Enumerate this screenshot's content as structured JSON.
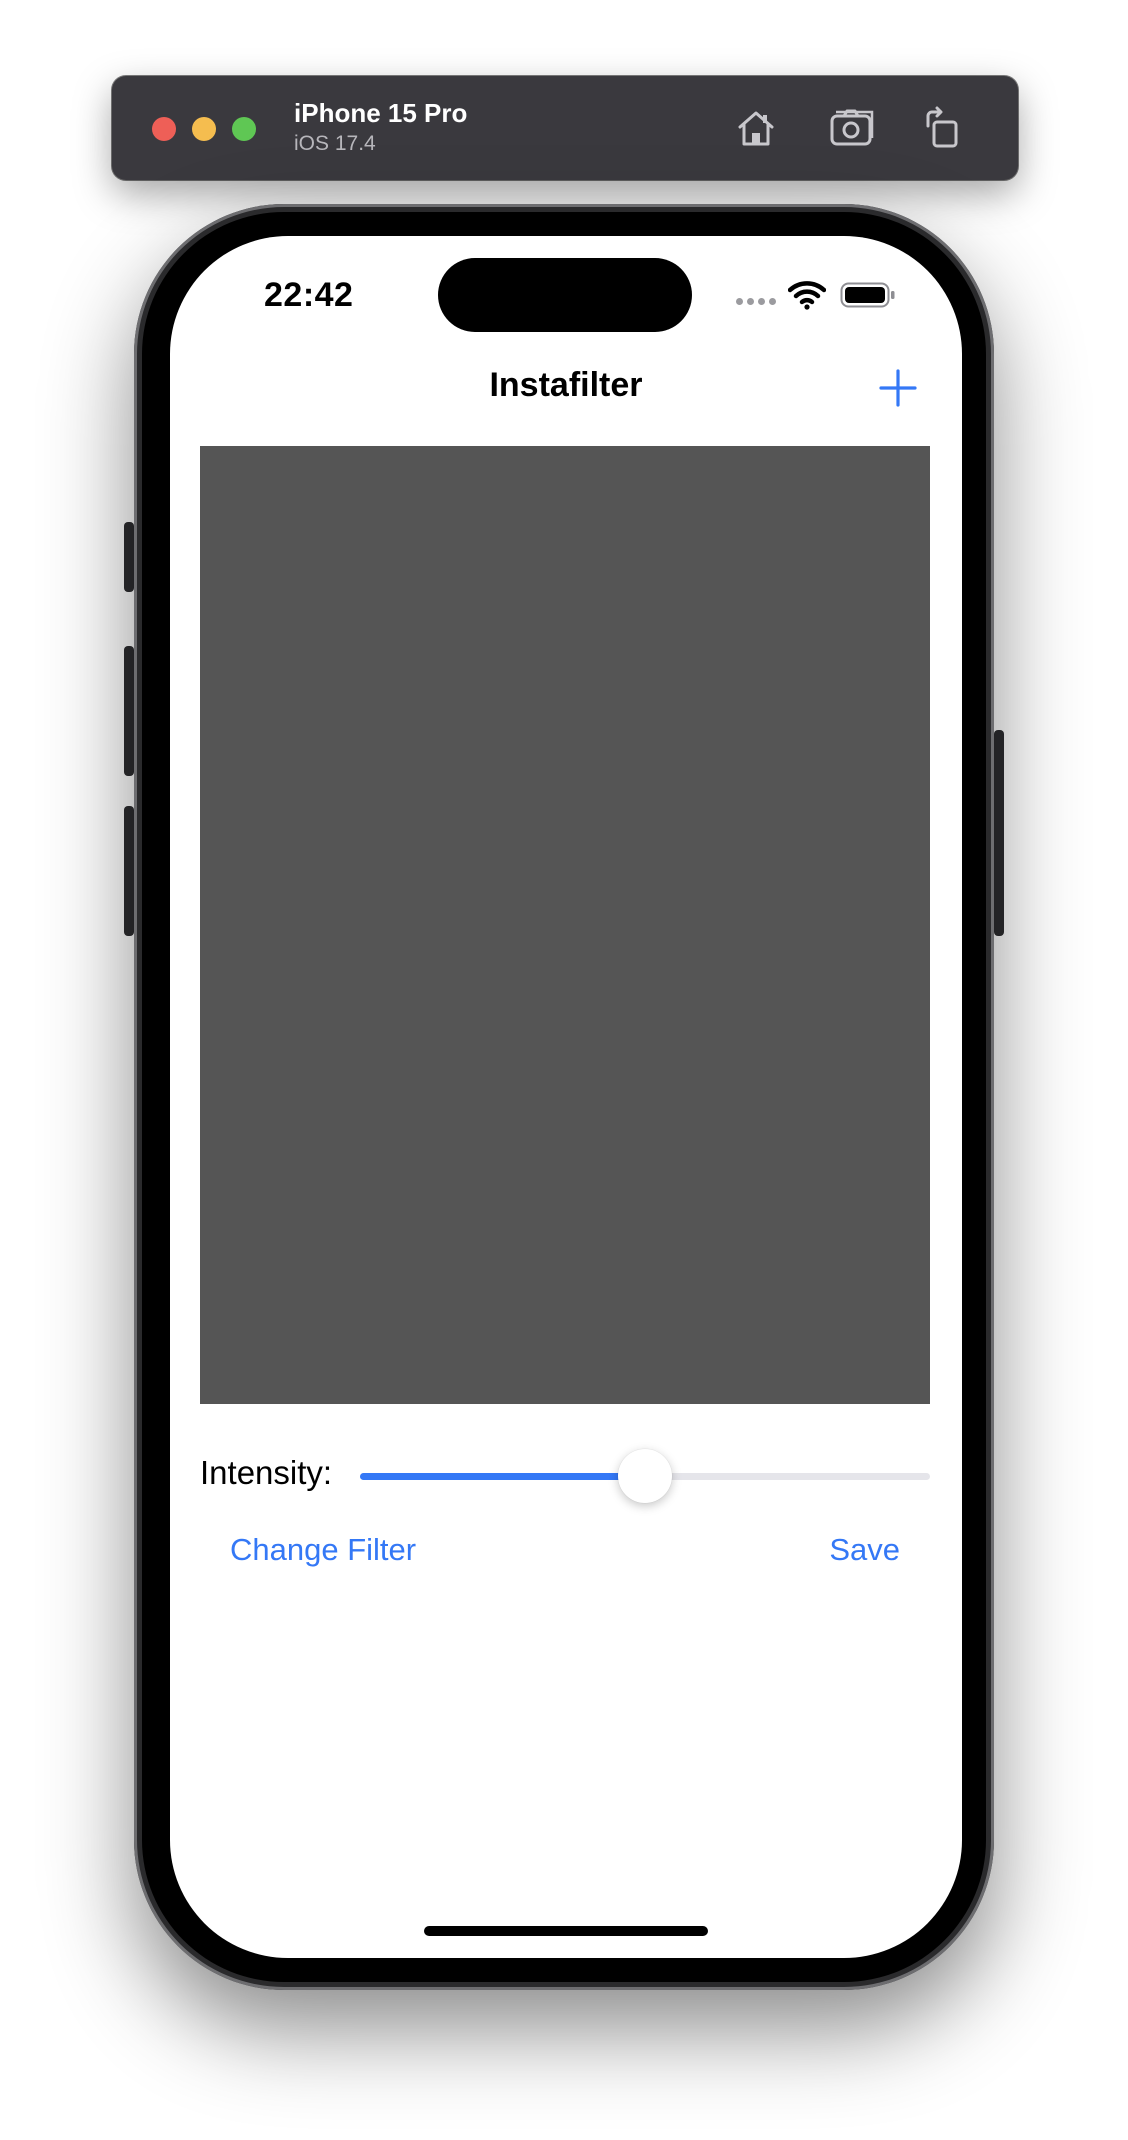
{
  "simulator": {
    "device_name": "iPhone 15 Pro",
    "os_version": "iOS 17.4",
    "icons": [
      "home-icon",
      "screenshot-icon",
      "rotate-icon"
    ]
  },
  "status_bar": {
    "time": "22:42"
  },
  "nav": {
    "title": "Instafilter",
    "add_icon": "plus-icon"
  },
  "controls": {
    "intensity_label": "Intensity:",
    "intensity_value": 0.5,
    "change_filter_label": "Change Filter",
    "save_label": "Save"
  },
  "colors": {
    "accent": "#3478f6",
    "image_placeholder": "#555555",
    "toolbar": "#3a393e"
  }
}
